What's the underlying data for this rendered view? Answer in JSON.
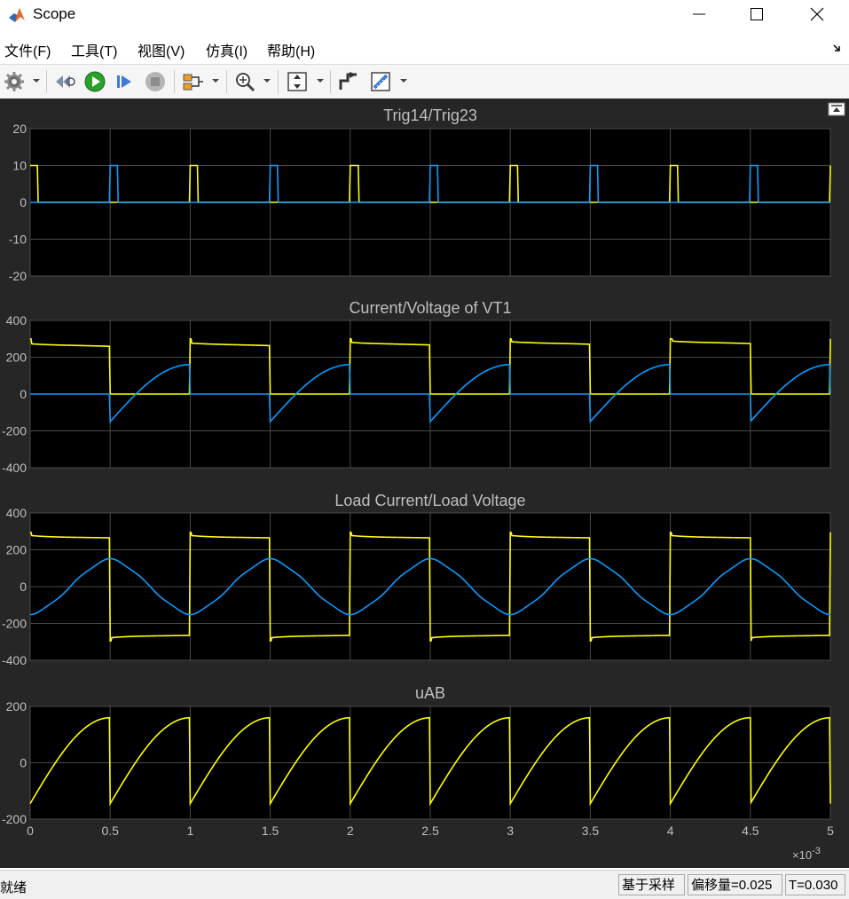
{
  "window": {
    "title": "Scope"
  },
  "menu": [
    {
      "label": "文件(F)"
    },
    {
      "label": "工具(T)"
    },
    {
      "label": "视图(V)"
    },
    {
      "label": "仿真(I)"
    },
    {
      "label": "帮助(H)"
    }
  ],
  "toolbar": {
    "icons": [
      "gear-icon",
      "rewind-icon",
      "run-icon",
      "step-forward-icon",
      "stop-icon",
      "signal-select-icon",
      "zoom-in-icon",
      "scale-axes-icon",
      "highlight-block-icon",
      "measurement-ruler-icon"
    ]
  },
  "colors": {
    "background": "#262626",
    "axes": "#000000",
    "grid": "#4a4a4a",
    "text": "#bfbfbf",
    "series_yellow": "#ffff00",
    "series_blue": "#0d9bff"
  },
  "chart_data": [
    {
      "type": "line",
      "title": "Trig14/Trig23",
      "x_range": [
        0,
        0.005
      ],
      "ylim": [
        -20,
        20
      ],
      "y_ticks": [
        20,
        10,
        0,
        -10,
        -20
      ],
      "grid": true,
      "series": [
        {
          "color": "#ffff00",
          "pulse_starts": [
            0,
            0.001,
            0.002,
            0.003,
            0.004,
            0.005
          ],
          "pulse_width": 5e-05,
          "high": 10,
          "low": 0
        },
        {
          "color": "#0d9bff",
          "pulse_starts": [
            0.0005,
            0.0015,
            0.0025,
            0.0035,
            0.0045
          ],
          "pulse_width": 5e-05,
          "high": 10,
          "low": 0
        }
      ]
    },
    {
      "type": "line",
      "title": "Current/Voltage of VT1",
      "x_range": [
        0,
        0.005
      ],
      "ylim": [
        -400,
        400
      ],
      "y_ticks": [
        400,
        200,
        0,
        -200,
        -400
      ],
      "grid": true,
      "series": [
        {
          "color": "#ffff00",
          "description_values": {
            "period": 0.001,
            "on_interval": [
              0,
              0.0005
            ],
            "start_value": 300,
            "plateau_start": 265,
            "plateau_end": 280,
            "off_value": 0
          }
        },
        {
          "color": "#0d9bff",
          "description_values": {
            "period": 0.001,
            "zero_interval": [
              0,
              0.0005
            ],
            "rise_start": -150,
            "rise_end": 160
          }
        }
      ]
    },
    {
      "type": "line",
      "title": "Load Current/Load Voltage",
      "x_range": [
        0,
        0.005
      ],
      "ylim": [
        -400,
        400
      ],
      "y_ticks": [
        400,
        200,
        0,
        -200,
        -400
      ],
      "grid": true,
      "series": [
        {
          "color": "#ffff00",
          "description_values": {
            "period": 0.001,
            "positive_level": 270,
            "negative_level": -270,
            "overshoot": 295
          }
        },
        {
          "color": "#0d9bff",
          "description_values": {
            "period": 0.001,
            "amplitude": 152,
            "min_at": [
              0,
              0.001,
              0.002,
              0.003,
              0.004,
              0.005
            ],
            "max_at": [
              0.0005,
              0.0015,
              0.0025,
              0.0035,
              0.0045
            ]
          }
        }
      ]
    },
    {
      "type": "line",
      "title": "uAB",
      "x_range": [
        0,
        0.005
      ],
      "ylim": [
        -200,
        200
      ],
      "y_ticks": [
        200,
        0,
        -200
      ],
      "grid": true,
      "x_ticks": [
        0,
        0.0005,
        0.001,
        0.0015,
        0.002,
        0.0025,
        0.003,
        0.0035,
        0.004,
        0.0045,
        0.005
      ],
      "x_tick_labels": [
        "0",
        "0.5",
        "1",
        "1.5",
        "2",
        "2.5",
        "3",
        "3.5",
        "4",
        "4.5",
        "5"
      ],
      "x_scale_label_base": "×10",
      "x_scale_label_exp": "-3",
      "series": [
        {
          "color": "#ffff00",
          "description_values": {
            "period": 0.0005,
            "start": -145,
            "end": 160
          }
        }
      ]
    }
  ],
  "status": {
    "ready": "就绪",
    "sample_based": "基于采样",
    "offset": "偏移量=0.025",
    "time": "T=0.030"
  }
}
